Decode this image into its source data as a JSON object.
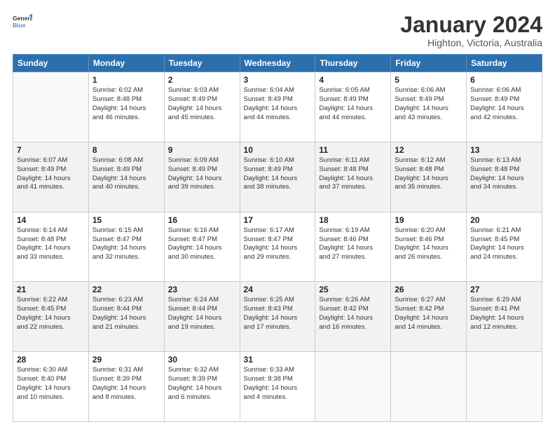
{
  "logo": {
    "line1": "General",
    "line2": "Blue"
  },
  "title": "January 2024",
  "subtitle": "Highton, Victoria, Australia",
  "days_header": [
    "Sunday",
    "Monday",
    "Tuesday",
    "Wednesday",
    "Thursday",
    "Friday",
    "Saturday"
  ],
  "weeks": [
    [
      {
        "num": "",
        "info": ""
      },
      {
        "num": "1",
        "info": "Sunrise: 6:02 AM\nSunset: 8:48 PM\nDaylight: 14 hours\nand 46 minutes."
      },
      {
        "num": "2",
        "info": "Sunrise: 6:03 AM\nSunset: 8:49 PM\nDaylight: 14 hours\nand 45 minutes."
      },
      {
        "num": "3",
        "info": "Sunrise: 6:04 AM\nSunset: 8:49 PM\nDaylight: 14 hours\nand 44 minutes."
      },
      {
        "num": "4",
        "info": "Sunrise: 6:05 AM\nSunset: 8:49 PM\nDaylight: 14 hours\nand 44 minutes."
      },
      {
        "num": "5",
        "info": "Sunrise: 6:06 AM\nSunset: 8:49 PM\nDaylight: 14 hours\nand 43 minutes."
      },
      {
        "num": "6",
        "info": "Sunrise: 6:06 AM\nSunset: 8:49 PM\nDaylight: 14 hours\nand 42 minutes."
      }
    ],
    [
      {
        "num": "7",
        "info": "Sunrise: 6:07 AM\nSunset: 8:49 PM\nDaylight: 14 hours\nand 41 minutes."
      },
      {
        "num": "8",
        "info": "Sunrise: 6:08 AM\nSunset: 8:49 PM\nDaylight: 14 hours\nand 40 minutes."
      },
      {
        "num": "9",
        "info": "Sunrise: 6:09 AM\nSunset: 8:49 PM\nDaylight: 14 hours\nand 39 minutes."
      },
      {
        "num": "10",
        "info": "Sunrise: 6:10 AM\nSunset: 8:49 PM\nDaylight: 14 hours\nand 38 minutes."
      },
      {
        "num": "11",
        "info": "Sunrise: 6:11 AM\nSunset: 8:48 PM\nDaylight: 14 hours\nand 37 minutes."
      },
      {
        "num": "12",
        "info": "Sunrise: 6:12 AM\nSunset: 8:48 PM\nDaylight: 14 hours\nand 35 minutes."
      },
      {
        "num": "13",
        "info": "Sunrise: 6:13 AM\nSunset: 8:48 PM\nDaylight: 14 hours\nand 34 minutes."
      }
    ],
    [
      {
        "num": "14",
        "info": "Sunrise: 6:14 AM\nSunset: 8:48 PM\nDaylight: 14 hours\nand 33 minutes."
      },
      {
        "num": "15",
        "info": "Sunrise: 6:15 AM\nSunset: 8:47 PM\nDaylight: 14 hours\nand 32 minutes."
      },
      {
        "num": "16",
        "info": "Sunrise: 6:16 AM\nSunset: 8:47 PM\nDaylight: 14 hours\nand 30 minutes."
      },
      {
        "num": "17",
        "info": "Sunrise: 6:17 AM\nSunset: 8:47 PM\nDaylight: 14 hours\nand 29 minutes."
      },
      {
        "num": "18",
        "info": "Sunrise: 6:19 AM\nSunset: 8:46 PM\nDaylight: 14 hours\nand 27 minutes."
      },
      {
        "num": "19",
        "info": "Sunrise: 6:20 AM\nSunset: 8:46 PM\nDaylight: 14 hours\nand 26 minutes."
      },
      {
        "num": "20",
        "info": "Sunrise: 6:21 AM\nSunset: 8:45 PM\nDaylight: 14 hours\nand 24 minutes."
      }
    ],
    [
      {
        "num": "21",
        "info": "Sunrise: 6:22 AM\nSunset: 8:45 PM\nDaylight: 14 hours\nand 22 minutes."
      },
      {
        "num": "22",
        "info": "Sunrise: 6:23 AM\nSunset: 8:44 PM\nDaylight: 14 hours\nand 21 minutes."
      },
      {
        "num": "23",
        "info": "Sunrise: 6:24 AM\nSunset: 8:44 PM\nDaylight: 14 hours\nand 19 minutes."
      },
      {
        "num": "24",
        "info": "Sunrise: 6:25 AM\nSunset: 8:43 PM\nDaylight: 14 hours\nand 17 minutes."
      },
      {
        "num": "25",
        "info": "Sunrise: 6:26 AM\nSunset: 8:42 PM\nDaylight: 14 hours\nand 16 minutes."
      },
      {
        "num": "26",
        "info": "Sunrise: 6:27 AM\nSunset: 8:42 PM\nDaylight: 14 hours\nand 14 minutes."
      },
      {
        "num": "27",
        "info": "Sunrise: 6:29 AM\nSunset: 8:41 PM\nDaylight: 14 hours\nand 12 minutes."
      }
    ],
    [
      {
        "num": "28",
        "info": "Sunrise: 6:30 AM\nSunset: 8:40 PM\nDaylight: 14 hours\nand 10 minutes."
      },
      {
        "num": "29",
        "info": "Sunrise: 6:31 AM\nSunset: 8:39 PM\nDaylight: 14 hours\nand 8 minutes."
      },
      {
        "num": "30",
        "info": "Sunrise: 6:32 AM\nSunset: 8:39 PM\nDaylight: 14 hours\nand 6 minutes."
      },
      {
        "num": "31",
        "info": "Sunrise: 6:33 AM\nSunset: 8:38 PM\nDaylight: 14 hours\nand 4 minutes."
      },
      {
        "num": "",
        "info": ""
      },
      {
        "num": "",
        "info": ""
      },
      {
        "num": "",
        "info": ""
      }
    ]
  ]
}
